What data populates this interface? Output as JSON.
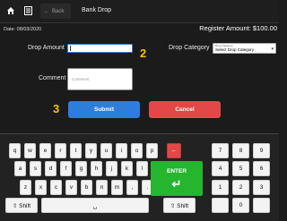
{
  "header": {
    "back_label": "Back",
    "title": "Bank Drop"
  },
  "info": {
    "date": "Date: 08/03/2020",
    "register_cash": "Register Amount: $100.00"
  },
  "form": {
    "drop_amount_label": "Drop Amount",
    "drop_amount_value": "",
    "drop_category_label": "Drop Category",
    "drop_category_small_label": "Drop Category",
    "drop_category_selected": "Select Drop Category",
    "comment_label": "Comment",
    "comment_placeholder": "Comment",
    "submit_label": "Submit",
    "cancel_label": "Cancel"
  },
  "annotations": {
    "step_2": "2",
    "step_3": "3"
  },
  "keyboard": {
    "row1": [
      "q",
      "w",
      "e",
      "r",
      "t",
      "y",
      "u",
      "i",
      "o",
      "p"
    ],
    "row2": [
      "a",
      "s",
      "d",
      "f",
      "g",
      "h",
      "j",
      "k",
      "l"
    ],
    "row3": [
      "z",
      "x",
      "c",
      "v",
      "b",
      "n",
      "m",
      ",",
      "."
    ],
    "shift_label": "⇧ Shift",
    "space_label": "␣",
    "enter_label": "ENTER",
    "numpad_rows": [
      [
        "7",
        "8",
        "9"
      ],
      [
        "4",
        "5",
        "6"
      ],
      [
        "1",
        "2",
        "3"
      ],
      [
        "",
        "0",
        ""
      ]
    ]
  },
  "colors": {
    "accent_blue": "#2f7ddb",
    "cancel_red": "#e24848",
    "enter_green": "#25b52f",
    "annotation_yellow": "#f2c200"
  }
}
